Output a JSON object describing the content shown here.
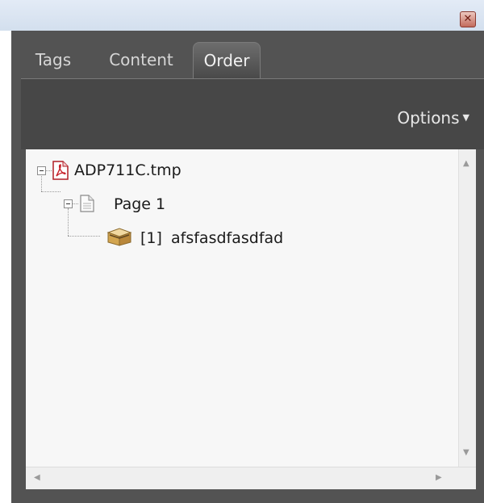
{
  "panel": {
    "tabs": [
      {
        "label": "Tags",
        "active": false
      },
      {
        "label": "Content",
        "active": false
      },
      {
        "label": "Order",
        "active": true
      }
    ],
    "options_label": "Options"
  },
  "tree": {
    "root": {
      "label": "ADP711C.tmp",
      "icon": "pdf-file-icon"
    },
    "page": {
      "label": "Page 1",
      "icon": "page-icon"
    },
    "item": {
      "index": "[1]",
      "label": "afsfasdfasdfad",
      "icon": "container-box-icon"
    }
  },
  "colors": {
    "panel_bg": "#535353",
    "toolbar_bg": "#474747",
    "tree_bg": "#f7f7f7",
    "pdf_red": "#c8202a"
  }
}
